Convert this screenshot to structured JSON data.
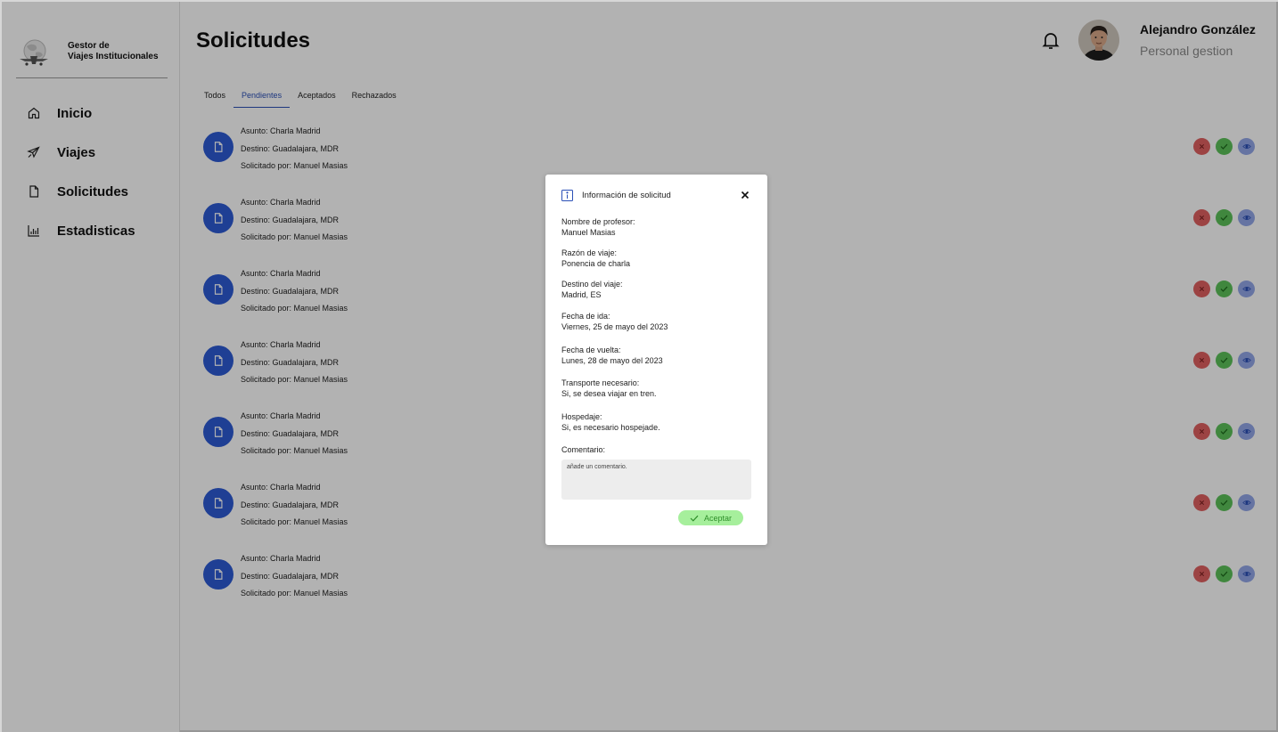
{
  "brand": {
    "line1": "Gestor de",
    "line2": "Viajes Institucionales",
    "logo_icon": "globe-plane-logo"
  },
  "nav": [
    {
      "label": "Inicio",
      "icon": "home-icon"
    },
    {
      "label": "Viajes",
      "icon": "plane-icon"
    },
    {
      "label": "Solicitudes",
      "icon": "file-icon"
    },
    {
      "label": "Estadisticas",
      "icon": "bar-chart-icon"
    }
  ],
  "header": {
    "title": "Solicitudes",
    "user_name": "Alejandro González",
    "user_role": "Personal gestion"
  },
  "tabs": [
    {
      "label": "Todos",
      "active": false
    },
    {
      "label": "Pendientes",
      "active": true
    },
    {
      "label": "Aceptados",
      "active": false
    },
    {
      "label": "Rechazados",
      "active": false
    }
  ],
  "requests": [
    {
      "subject": "Asunto: Charla Madrid",
      "destination": "Destino: Guadalajara, MDR",
      "requested_by": "Solicitado por:  Manuel Masias"
    },
    {
      "subject": "Asunto: Charla Madrid",
      "destination": "Destino: Guadalajara, MDR",
      "requested_by": "Solicitado por:  Manuel Masias"
    },
    {
      "subject": "Asunto: Charla Madrid",
      "destination": "Destino: Guadalajara, MDR",
      "requested_by": "Solicitado por:  Manuel Masias"
    },
    {
      "subject": "Asunto: Charla Madrid",
      "destination": "Destino: Guadalajara, MDR",
      "requested_by": "Solicitado por:  Manuel Masias"
    },
    {
      "subject": "Asunto: Charla Madrid",
      "destination": "Destino: Guadalajara, MDR",
      "requested_by": "Solicitado por:  Manuel Masias"
    },
    {
      "subject": "Asunto: Charla Madrid",
      "destination": "Destino: Guadalajara, MDR",
      "requested_by": "Solicitado por:  Manuel Masias"
    },
    {
      "subject": "Asunto: Charla Madrid",
      "destination": "Destino: Guadalajara, MDR",
      "requested_by": "Solicitado por:  Manuel Masias"
    }
  ],
  "modal": {
    "title": "Información de solicitud",
    "fields": [
      {
        "label": "Nombre de profesor:",
        "value": "Manuel Masias"
      },
      {
        "label": "Razón de viaje:",
        "value": "Ponencia de charla"
      },
      {
        "label": "Destino del viaje:",
        "value": "Madrid, ES"
      },
      {
        "label": "Fecha de ida:",
        "value": "Viernes, 25 de mayo del 2023"
      },
      {
        "label": "Fecha de vuelta:",
        "value": "Lunes, 28 de mayo del 2023"
      },
      {
        "label": "Transporte necesario:",
        "value": "Si, se desea viajar en tren."
      },
      {
        "label": "Hospedaje:",
        "value": "Si, es necesario hospejade."
      }
    ],
    "comment_label": "Comentario:",
    "comment_placeholder": "añade un comentario.",
    "accept_label": "Aceptar"
  },
  "colors": {
    "accent_blue": "#2a4fb6",
    "reject_red": "#e06161",
    "accept_green": "#5cc25a",
    "view_blue": "#93a6e8",
    "accept_button_bg": "#a6ef9c"
  }
}
